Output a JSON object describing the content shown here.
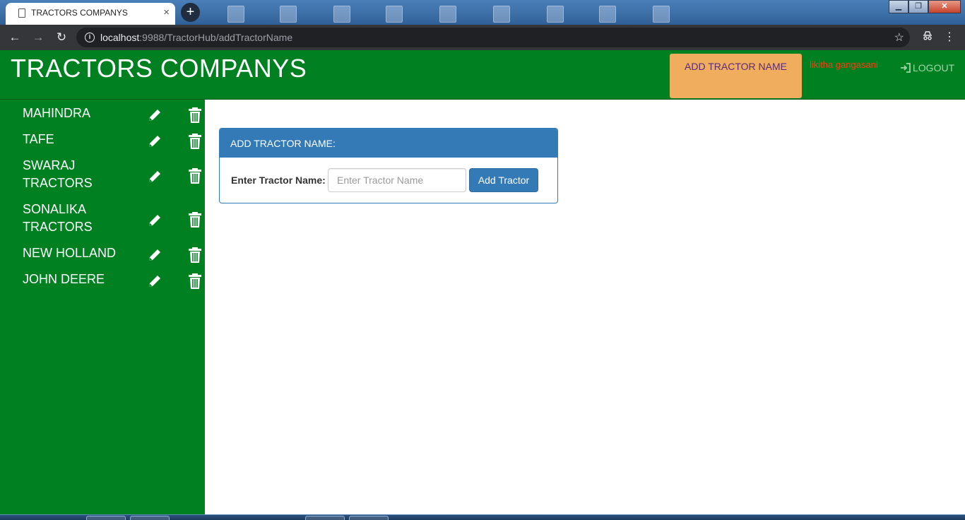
{
  "browser": {
    "tab_title": "TRACTORS COMPANYS",
    "tab_close": "×",
    "new_tab": "+",
    "url_host": "localhost",
    "url_rest": ":9988/TractorHub/addTractorName",
    "back": "←",
    "forward": "→",
    "reload": "↻",
    "star": "☆",
    "menu": "⋮"
  },
  "header": {
    "title": "TRACTORS COMPANYS",
    "nav_add": "ADD TRACTOR NAME",
    "user": "likitha gangasani",
    "logout": "LOGOUT"
  },
  "sidebar": {
    "items": [
      {
        "label": "MAHINDRA"
      },
      {
        "label": "TAFE"
      },
      {
        "label": "SWARAJ TRACTORS"
      },
      {
        "label": "SONALIKA TRACTORS"
      },
      {
        "label": "NEW HOLLAND"
      },
      {
        "label": "JOHN DEERE"
      }
    ]
  },
  "panel": {
    "heading": "ADD TRACTOR NAME:",
    "field_label": "Enter Tractor Name:",
    "input_placeholder": "Enter Tractor Name",
    "input_value": "",
    "button": "Add Tractor"
  },
  "colors": {
    "header_green": "#008020",
    "nav_active": "#f0ad5e",
    "panel_blue": "#337ab7",
    "user_red": "#ff3a0f"
  }
}
